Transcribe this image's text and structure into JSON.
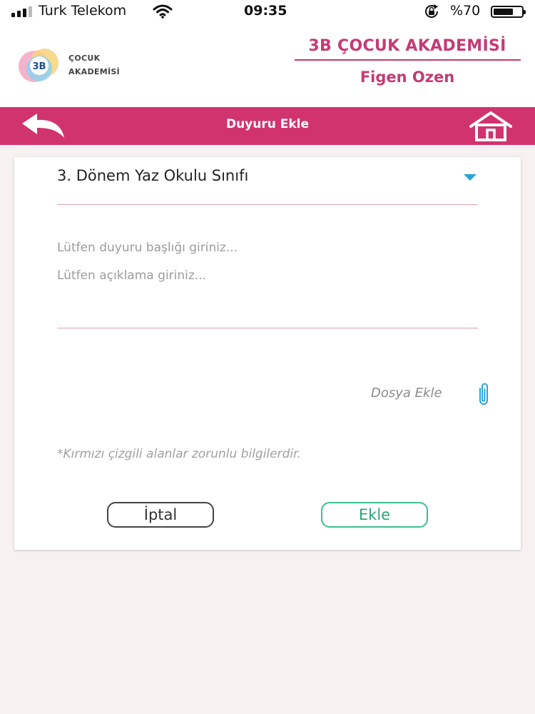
{
  "status_bar": {
    "carrier": "Turk Telekom",
    "time": "09:35",
    "battery": "%70",
    "battery_level": 0.7
  },
  "header": {
    "logo_mark": "3B",
    "logo_line1": "ÇOCUK",
    "logo_line2": "AKADEMİSİ",
    "brand": "3B ÇOCUK AKADEMİSİ",
    "user_name": "Figen Ozen"
  },
  "navbar": {
    "title": "Duyuru Ekle",
    "back_icon": "back-arrow-icon",
    "home_icon": "home-icon"
  },
  "form": {
    "class_select_value": "3. Dönem Yaz Okulu Sınıfı",
    "title_placeholder": "Lütfen duyuru başlığı giriniz...",
    "description_placeholder": "Lütfen açıklama giriniz...",
    "attach_label": "Dosya Ekle",
    "required_note": "*Kırmızı çizgili alanlar zorunlu bilgilerdir.",
    "cancel_label": "İptal",
    "submit_label": "Ekle"
  },
  "colors": {
    "accent": "#d1336f",
    "brand_text": "#c63a75",
    "caret": "#27a5d8",
    "submit": "#3cbf8c"
  }
}
